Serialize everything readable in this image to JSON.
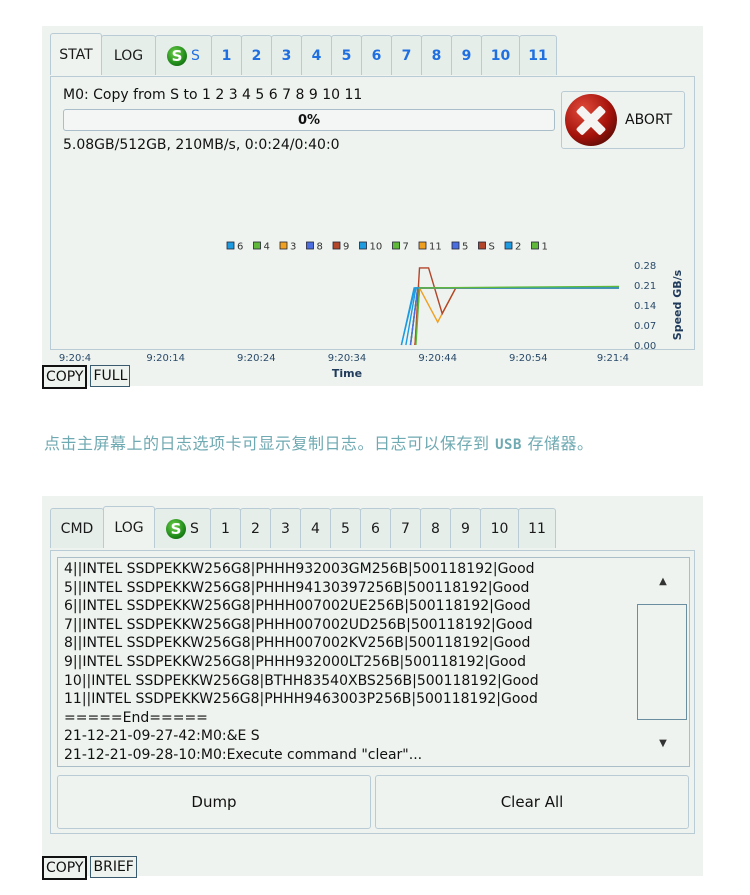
{
  "screen1": {
    "tabs": [
      {
        "label": "STAT",
        "active": true
      },
      {
        "label": "LOG"
      },
      {
        "label": "S",
        "icon": "source-drive-icon"
      },
      {
        "label": "1"
      },
      {
        "label": "2"
      },
      {
        "label": "3"
      },
      {
        "label": "4"
      },
      {
        "label": "5"
      },
      {
        "label": "6"
      },
      {
        "label": "7"
      },
      {
        "label": "8"
      },
      {
        "label": "9"
      },
      {
        "label": "10"
      },
      {
        "label": "11"
      }
    ],
    "s_icon_letter": "S",
    "copy_status": "M0: Copy from S to 1 2 3 4 5 6 7 8 9 10 11",
    "progress_percent": 0,
    "progress_label": "0%",
    "stats": "5.08GB/512GB, 210MB/s, 0:0:24/0:40:0",
    "abort_label": "ABORT",
    "mode_buttons": [
      {
        "label": "COPY",
        "selected": true
      },
      {
        "label": "FULL",
        "selected": false
      }
    ]
  },
  "chart_data": {
    "type": "line",
    "title": "",
    "xlabel": "Time",
    "ylabel": "Speed GB/s",
    "x_ticks": [
      "9:20:4",
      "9:20:14",
      "9:20:24",
      "9:20:34",
      "9:20:44",
      "9:20:54",
      "9:21:4"
    ],
    "x_range_seconds": [
      0,
      60
    ],
    "y_ticks": [
      "0.28",
      "0.21",
      "0.14",
      "0.07",
      "0.00"
    ],
    "ylim": [
      0,
      0.28
    ],
    "legend": [
      "6",
      "4",
      "3",
      "8",
      "9",
      "10",
      "7",
      "11",
      "5",
      "S",
      "2",
      "1"
    ],
    "legend_position": "top",
    "series": [
      {
        "name": "6",
        "color": "#1e9be0",
        "points": [
          [
            36,
            0
          ],
          [
            37.5,
            0.2
          ],
          [
            40,
            0.2
          ],
          [
            60,
            0.2
          ]
        ]
      },
      {
        "name": "4",
        "color": "#5fb83a",
        "points": [
          [
            37,
            0
          ],
          [
            37.8,
            0.2
          ],
          [
            60,
            0.2
          ]
        ]
      },
      {
        "name": "3",
        "color": "#f0a020",
        "points": [
          [
            37.5,
            0
          ],
          [
            38,
            0.2
          ],
          [
            40,
            0.08
          ],
          [
            42,
            0.2
          ],
          [
            60,
            0.2
          ]
        ]
      },
      {
        "name": "8",
        "color": "#4a6ee0",
        "points": [
          [
            37,
            0
          ],
          [
            37.8,
            0.2
          ],
          [
            60,
            0.2
          ]
        ]
      },
      {
        "name": "9",
        "color": "#b2452a",
        "points": [
          [
            37.5,
            0
          ],
          [
            38,
            0.27
          ],
          [
            39,
            0.27
          ],
          [
            40.5,
            0.11
          ],
          [
            42,
            0.2
          ],
          [
            60,
            0.2
          ]
        ]
      },
      {
        "name": "10",
        "color": "#1e9be0",
        "points": [
          [
            36.5,
            0
          ],
          [
            37.6,
            0.2
          ],
          [
            60,
            0.2
          ]
        ]
      },
      {
        "name": "7",
        "color": "#5fb83a",
        "points": [
          [
            37,
            0
          ],
          [
            37.8,
            0.2
          ],
          [
            60,
            0.2
          ]
        ]
      },
      {
        "name": "11",
        "color": "#f0a020",
        "points": [
          [
            37.5,
            0
          ],
          [
            38,
            0.2
          ],
          [
            60,
            0.2
          ]
        ]
      },
      {
        "name": "5",
        "color": "#4a6ee0",
        "points": [
          [
            37,
            0
          ],
          [
            37.8,
            0.2
          ],
          [
            60,
            0.2
          ]
        ]
      },
      {
        "name": "S",
        "color": "#b2452a",
        "points": [
          [
            37.5,
            0
          ],
          [
            38,
            0.2
          ],
          [
            60,
            0.2
          ]
        ]
      },
      {
        "name": "2",
        "color": "#1e9be0",
        "points": [
          [
            36,
            0
          ],
          [
            37.4,
            0.2
          ],
          [
            60,
            0.2
          ]
        ]
      },
      {
        "name": "1",
        "color": "#5fb83a",
        "points": [
          [
            37.6,
            0
          ],
          [
            38,
            0.2
          ],
          [
            60,
            0.205
          ]
        ]
      }
    ]
  },
  "caption": {
    "before": "点击主屏幕上的日志选项卡可显示复制日志。日志可以保存到 ",
    "usb": "USB",
    "after": " 存储器。"
  },
  "screen2": {
    "tabs": [
      {
        "label": "CMD"
      },
      {
        "label": "LOG",
        "active": true
      },
      {
        "label": "S",
        "icon": "source-drive-icon"
      },
      {
        "label": "1"
      },
      {
        "label": "2"
      },
      {
        "label": "3"
      },
      {
        "label": "4"
      },
      {
        "label": "5"
      },
      {
        "label": "6"
      },
      {
        "label": "7"
      },
      {
        "label": "8"
      },
      {
        "label": "9"
      },
      {
        "label": "10"
      },
      {
        "label": "11"
      }
    ],
    "s_icon_letter": "S",
    "log_lines": [
      "4||INTEL SSDPEKKW256G8|PHHH932003GM256B|500118192|Good",
      "5||INTEL SSDPEKKW256G8|PHHH94130397256B|500118192|Good",
      "6||INTEL SSDPEKKW256G8|PHHH007002UE256B|500118192|Good",
      "7||INTEL SSDPEKKW256G8|PHHH007002UD256B|500118192|Good",
      "8||INTEL SSDPEKKW256G8|PHHH007002KV256B|500118192|Good",
      "9||INTEL SSDPEKKW256G8|PHHH932000LT256B|500118192|Good",
      "10||INTEL SSDPEKKW256G8|BTHH83540XBS256B|500118192|Good",
      "11||INTEL SSDPEKKW256G8|PHHH9463003P256B|500118192|Good",
      "=====End=====",
      "21-12-21-09-27-42:M0:&E S",
      "21-12-21-09-28-10:M0:Execute command \"clear\"..."
    ],
    "scroll_up_glyph": "▲",
    "scroll_down_glyph": "▼",
    "dump_label": "Dump",
    "clear_label": "Clear All",
    "mode_buttons": [
      {
        "label": "COPY",
        "selected": true
      },
      {
        "label": "BRIEF",
        "selected": false
      }
    ]
  }
}
